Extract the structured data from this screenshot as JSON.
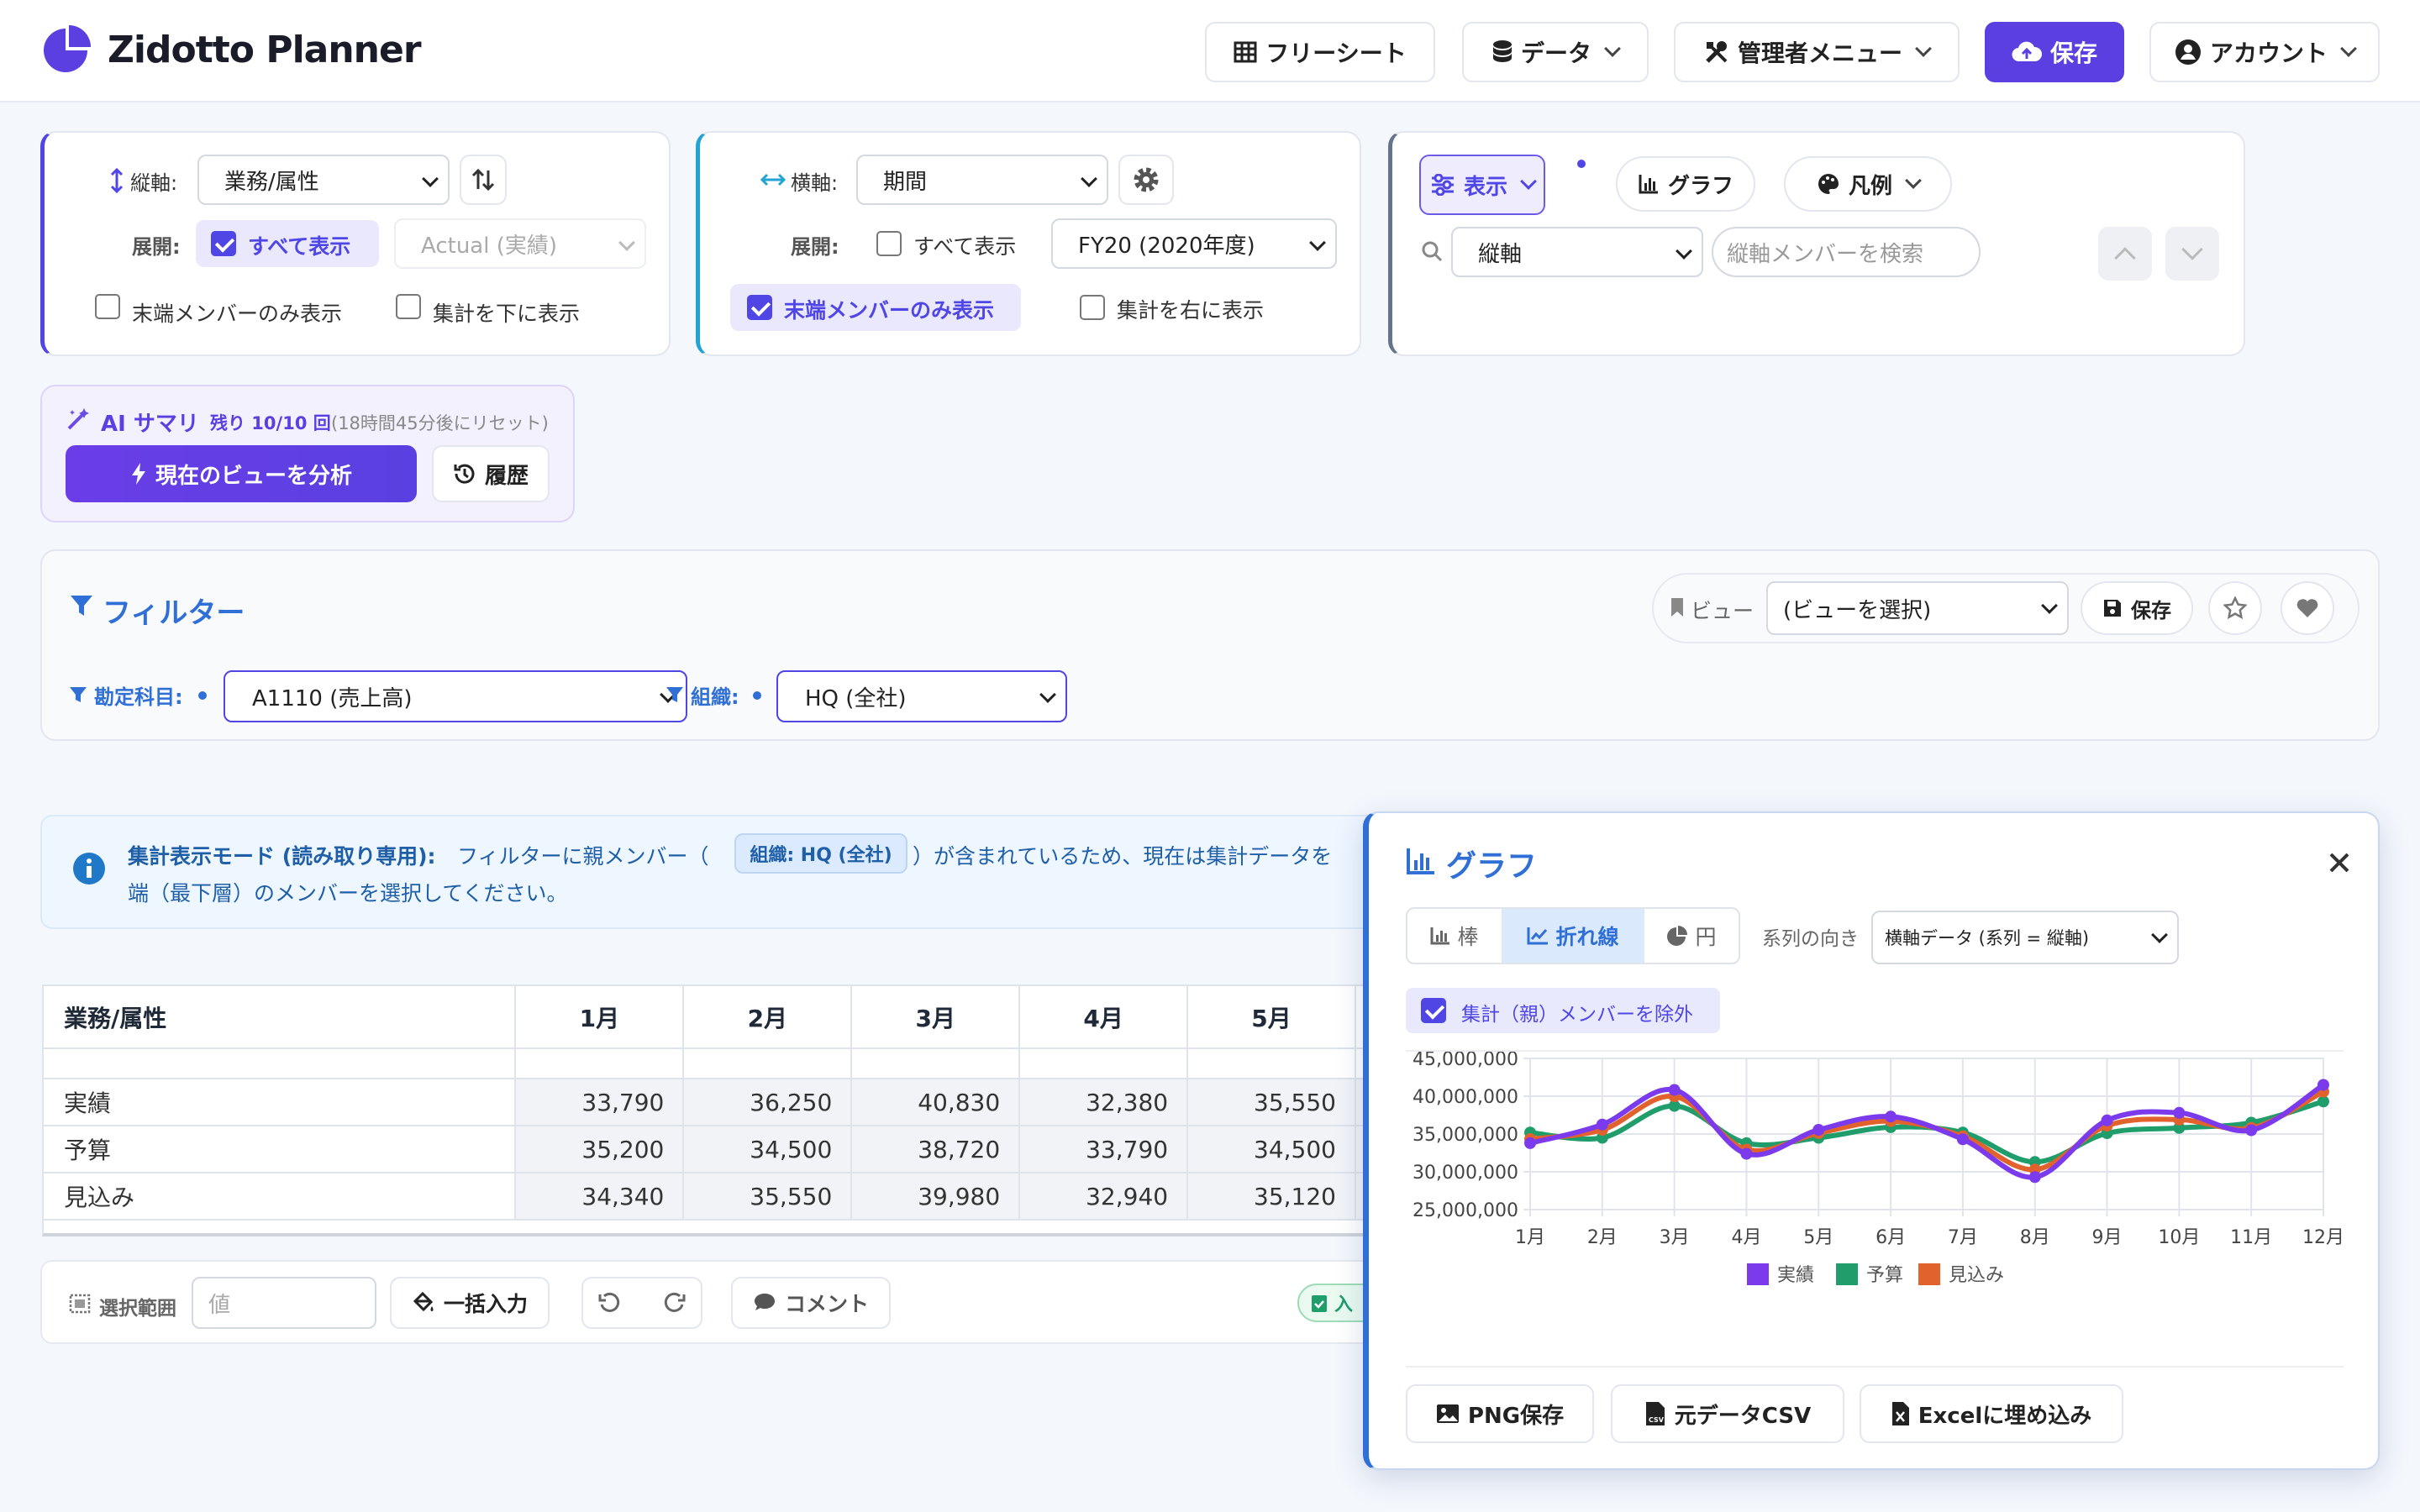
{
  "app": {
    "title": "Zidotto Planner"
  },
  "header": {
    "freesheet": "フリーシート",
    "data": "データ",
    "admin": "管理者メニュー",
    "save": "保存",
    "account": "アカウント"
  },
  "vertical": {
    "label": "縦軸:",
    "axis_value": "業務/属性",
    "expand_label": "展開:",
    "show_all": "すべて表示",
    "scenario_value": "Actual (実績)",
    "leaf_only": "末端メンバーのみ表示",
    "total_below": "集計を下に表示"
  },
  "horizontal": {
    "label": "横軸:",
    "axis_value": "期間",
    "expand_label": "展開:",
    "show_all": "すべて表示",
    "period_value": "FY20 (2020年度)",
    "leaf_only": "末端メンバーのみ表示",
    "total_right": "集計を右に表示"
  },
  "display": {
    "display_btn": "表示",
    "graph_btn": "グラフ",
    "legend_btn": "凡例",
    "search_axis": "縦軸",
    "search_placeholder": "縦軸メンバーを検索"
  },
  "ai": {
    "title": "AI サマリ",
    "remaining": "残り 10/10 回",
    "reset": "(18時間45分後にリセット)",
    "analyze": "現在のビューを分析",
    "history": "履歴"
  },
  "filter": {
    "title": "フィルター",
    "view_label": "ビュー",
    "view_select": "(ビューを選択)",
    "save": "保存",
    "account_label": "勘定科目:",
    "account_value": "A1110 (売上高)",
    "org_label": "組織:",
    "org_value": "HQ (全社)"
  },
  "notice": {
    "strong": "集計表示モード (読み取り専用):",
    "text1": "フィルターに親メンバー（",
    "badge": "組織: HQ (全社)",
    "text2": "）が含まれているため、現在は集計データを",
    "text3": "端（最下層）のメンバーを選択してください。"
  },
  "table": {
    "corner": "業務/属性",
    "columns": [
      "1月",
      "2月",
      "3月",
      "4月",
      "5月"
    ],
    "rows": [
      {
        "name": "実績",
        "values": [
          "33,790",
          "36,250",
          "40,830",
          "32,380",
          "35,550"
        ]
      },
      {
        "name": "予算",
        "values": [
          "35,200",
          "34,500",
          "38,720",
          "33,790",
          "34,500"
        ]
      },
      {
        "name": "見込み",
        "values": [
          "34,340",
          "35,550",
          "39,980",
          "32,940",
          "35,120"
        ]
      }
    ]
  },
  "bottom": {
    "range_label": "選択範囲",
    "value_placeholder": "値",
    "bulk": "一括入力",
    "comment": "コメント",
    "badge_partial": "入"
  },
  "graph_panel": {
    "title": "グラフ",
    "tab_bar": "棒",
    "tab_line": "折れ線",
    "tab_pie": "円",
    "orientation_label": "系列の向き",
    "orientation_value": "横軸データ (系列 = 縦軸)",
    "exclude_parent": "集計（親）メンバーを除外",
    "png": "PNG保存",
    "csv": "元データCSV",
    "excel": "Excelに埋め込み"
  },
  "colors": {
    "accent": "#5b3fe0",
    "actual": "#7c3aed",
    "budget": "#1f9d6b",
    "forecast": "#e2622d"
  },
  "chart_data": {
    "type": "line",
    "x": [
      "1月",
      "2月",
      "3月",
      "4月",
      "5月",
      "6月",
      "7月",
      "8月",
      "9月",
      "10月",
      "11月",
      "12月"
    ],
    "ylim": [
      25000000,
      45000000
    ],
    "yticks": [
      "45,000,000",
      "40,000,000",
      "35,000,000",
      "30,000,000",
      "25,000,000"
    ],
    "series": [
      {
        "name": "実績",
        "color": "#7c3aed",
        "values": [
          33790000,
          36250000,
          40830000,
          32380000,
          35550000,
          37300000,
          34300000,
          29300000,
          36800000,
          37800000,
          35500000,
          41500000
        ]
      },
      {
        "name": "予算",
        "color": "#1f9d6b",
        "values": [
          35200000,
          34500000,
          38720000,
          33790000,
          34500000,
          35900000,
          35200000,
          31300000,
          35100000,
          35800000,
          36500000,
          39300000
        ]
      },
      {
        "name": "見込み",
        "color": "#e2622d",
        "values": [
          34340000,
          35550000,
          39980000,
          32940000,
          35120000,
          36700000,
          34700000,
          30300000,
          36100000,
          36900000,
          35800000,
          40600000
        ]
      }
    ],
    "grid": true,
    "legend": "bottom"
  }
}
